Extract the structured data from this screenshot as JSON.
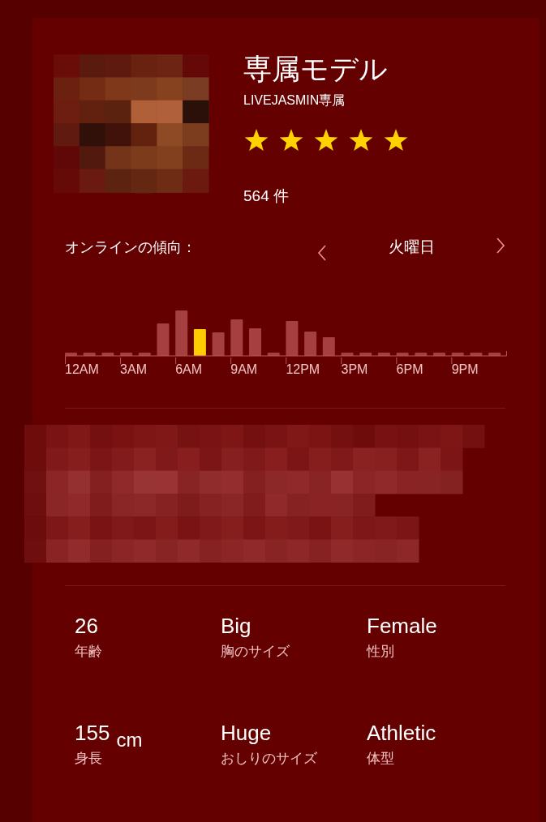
{
  "profile": {
    "title": "専属モデル",
    "subtitle": "LIVEJASMIN専属",
    "stars": 5,
    "review_count": "564 件"
  },
  "online_trend": {
    "label": "オンラインの傾向：",
    "day": "火曜日",
    "x_labels": [
      "12AM",
      "3AM",
      "6AM",
      "9AM",
      "12PM",
      "3PM",
      "6PM",
      "9PM"
    ]
  },
  "stats": [
    {
      "value": "26",
      "label": "年齢"
    },
    {
      "value": "Big",
      "label": "胸のサイズ"
    },
    {
      "value": "Female",
      "label": "性別"
    },
    {
      "value": "155",
      "unit": "cm",
      "label": "身長"
    },
    {
      "value": "Huge",
      "label": "おしりのサイズ"
    },
    {
      "value": "Athletic",
      "label": "体型"
    }
  ]
}
